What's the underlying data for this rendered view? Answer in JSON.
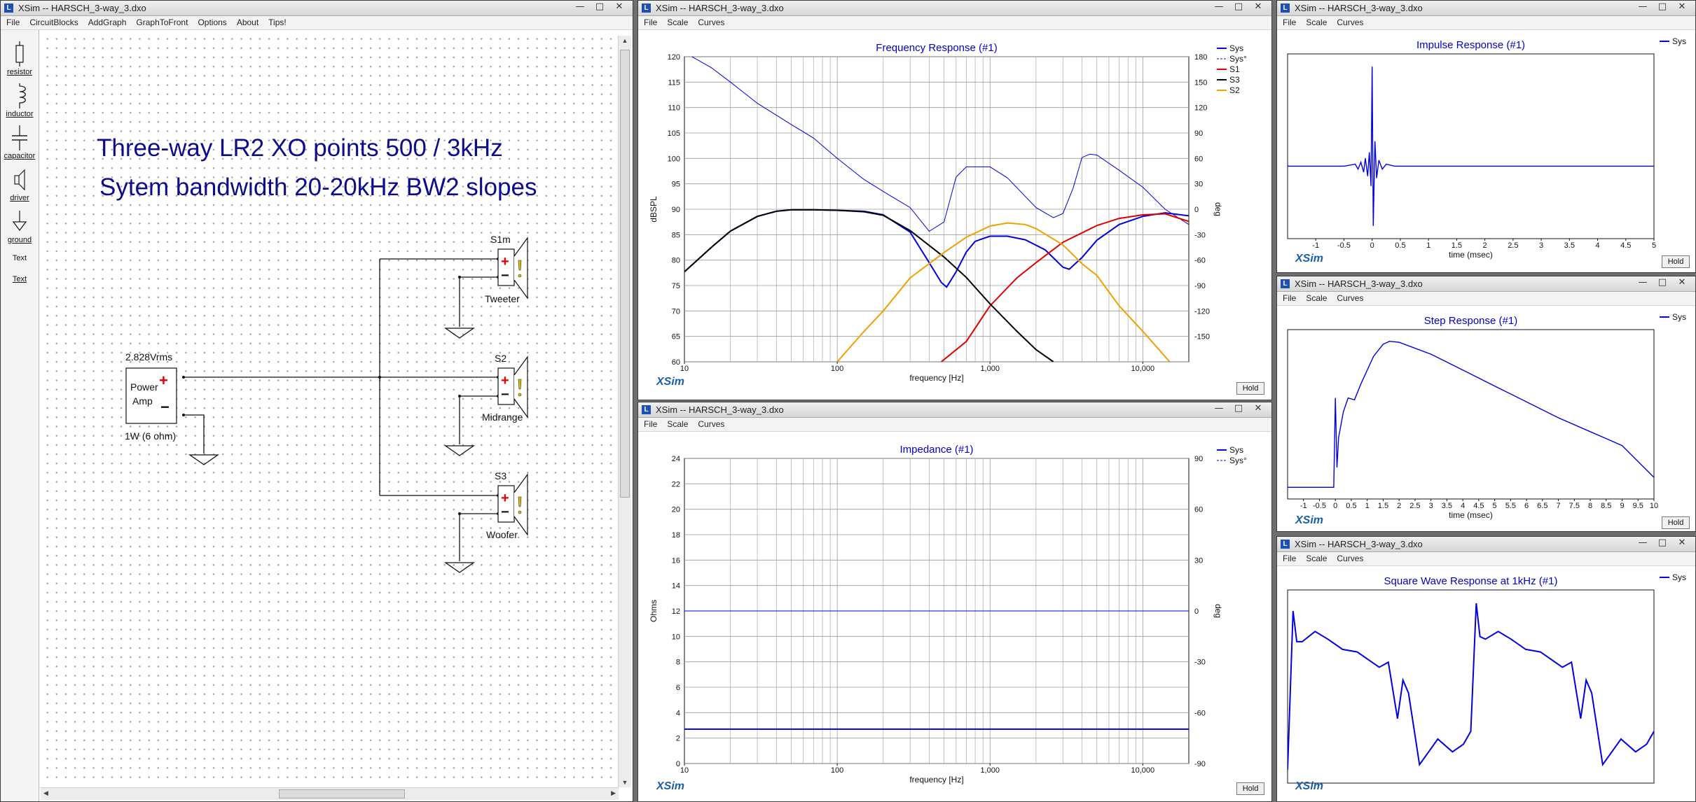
{
  "app_icon": "L",
  "window_controls": {
    "minimize": "—",
    "maximize": "□",
    "close": "✕"
  },
  "icons": [
    "resistor-icon",
    "inductor-icon",
    "capacitor-icon",
    "driver-icon",
    "ground-icon",
    "minimize-icon",
    "maximize-icon",
    "close-icon",
    "scroll-up-icon",
    "scroll-down-icon",
    "scroll-left-icon",
    "scroll-right-icon"
  ],
  "colors": {
    "title_blue": "#0000cc",
    "sys": "#0000e0",
    "s1": "#e00000",
    "s2": "#f0a000",
    "s3": "#000000",
    "xsim_logo": "#1b5fa8"
  },
  "schematic": {
    "title": "XSim -- HARSCH_3-way_3.dxo",
    "menu": [
      "File",
      "CircuitBlocks",
      "AddGraph",
      "GraphToFront",
      "Options",
      "About",
      "Tips!"
    ],
    "tools": [
      {
        "icon": "resistor-icon",
        "label": "resistor"
      },
      {
        "icon": "inductor-icon",
        "label": "inductor"
      },
      {
        "icon": "capacitor-icon",
        "label": "capacitor"
      },
      {
        "icon": "driver-icon",
        "label": "driver"
      },
      {
        "icon": "ground-icon",
        "label": "ground"
      },
      {
        "icon": "",
        "label": "Text"
      },
      {
        "icon": "",
        "label": "Text"
      }
    ],
    "heading1": "Three-way LR2 XO points 500 / 3kHz",
    "heading2": "Sytem bandwidth 20-20kHz BW2 slopes",
    "amp": {
      "line1": "Power",
      "line2": "Amp",
      "voltage": "2.828Vrms",
      "rating": "1W (6 ohm)",
      "plus": "+",
      "minus": "−"
    },
    "drivers": [
      {
        "id": "S1m",
        "name": "Tweeter"
      },
      {
        "id": "S2",
        "name": "Midrange"
      },
      {
        "id": "S3",
        "name": "Woofer"
      }
    ]
  },
  "freq_window": {
    "title": "XSim -- HARSCH_3-way_3.dxo",
    "menu": [
      "File",
      "Scale",
      "Curves"
    ],
    "logo": "XSim",
    "hold": "Hold",
    "chart_data": {
      "type": "line",
      "title": "Frequency Response (#1)",
      "xlabel": "frequency [Hz]",
      "ylabel": "dBSPL",
      "y2label": "deg",
      "xscale": "log",
      "xlim": [
        10,
        20000
      ],
      "ylim": [
        60,
        120
      ],
      "y2lim": [
        -180,
        180
      ],
      "x_ticks": [
        "10",
        "100",
        "1,000",
        "10,000"
      ],
      "y_ticks": [
        "60",
        "65",
        "70",
        "75",
        "80",
        "85",
        "90",
        "95",
        "100",
        "105",
        "110",
        "115",
        "120"
      ],
      "y2_ticks": [
        "-150",
        "-120",
        "-90",
        "-60",
        "-30",
        "0",
        "30",
        "60",
        "90",
        "120",
        "150",
        "180"
      ],
      "legend": [
        "Sys",
        "Sys°",
        "S1",
        "S3",
        "S2"
      ],
      "legend_position": "top-right",
      "grid": true,
      "series": [
        {
          "name": "Sys",
          "axis": "left",
          "points": [
            [
              10,
              77.7
            ],
            [
              15,
              82.5
            ],
            [
              20,
              85.7
            ],
            [
              30,
              88.6
            ],
            [
              40,
              89.6
            ],
            [
              50,
              89.9
            ],
            [
              70,
              89.9
            ],
            [
              100,
              89.8
            ],
            [
              150,
              89.6
            ],
            [
              200,
              88.9
            ],
            [
              300,
              85.5
            ],
            [
              400,
              79.5
            ],
            [
              480,
              75.6
            ],
            [
              520,
              74.7
            ],
            [
              600,
              77.7
            ],
            [
              700,
              81.6
            ],
            [
              800,
              83.7
            ],
            [
              1000,
              84.7
            ],
            [
              1300,
              84.7
            ],
            [
              1700,
              84.0
            ],
            [
              2300,
              82.0
            ],
            [
              3000,
              78.6
            ],
            [
              3300,
              78.2
            ],
            [
              4000,
              80.5
            ],
            [
              5000,
              83.9
            ],
            [
              7000,
              87.0
            ],
            [
              10000,
              88.6
            ],
            [
              14000,
              89.3
            ],
            [
              20000,
              88.7
            ]
          ]
        },
        {
          "name": "Sys°",
          "axis": "right",
          "points": [
            [
              10,
              185
            ],
            [
              15,
              167
            ],
            [
              20,
              150
            ],
            [
              30,
              125
            ],
            [
              50,
              100
            ],
            [
              70,
              84
            ],
            [
              100,
              60
            ],
            [
              150,
              35
            ],
            [
              200,
              21
            ],
            [
              300,
              2
            ],
            [
              400,
              -26
            ],
            [
              500,
              -15
            ],
            [
              600,
              38
            ],
            [
              700,
              50
            ],
            [
              1000,
              50
            ],
            [
              1300,
              37
            ],
            [
              2000,
              2
            ],
            [
              2600,
              -10
            ],
            [
              3000,
              -5
            ],
            [
              3500,
              25
            ],
            [
              4000,
              61
            ],
            [
              4500,
              65
            ],
            [
              5000,
              64
            ],
            [
              7000,
              46
            ],
            [
              10000,
              26
            ],
            [
              14000,
              0
            ],
            [
              20000,
              -18
            ]
          ]
        },
        {
          "name": "S1",
          "axis": "left",
          "points": [
            [
              480,
              60
            ],
            [
              700,
              64
            ],
            [
              1000,
              71
            ],
            [
              1500,
              76.5
            ],
            [
              2000,
              79.5
            ],
            [
              3000,
              83.5
            ],
            [
              5000,
              86.8
            ],
            [
              7000,
              88.2
            ],
            [
              10000,
              88.9
            ],
            [
              14000,
              89.1
            ],
            [
              20000,
              87.6
            ]
          ]
        },
        {
          "name": "S3",
          "axis": "left",
          "points": [
            [
              10,
              77.7
            ],
            [
              15,
              82.5
            ],
            [
              20,
              85.7
            ],
            [
              30,
              88.6
            ],
            [
              40,
              89.6
            ],
            [
              50,
              89.9
            ],
            [
              70,
              89.9
            ],
            [
              100,
              89.8
            ],
            [
              150,
              89.5
            ],
            [
              200,
              88.8
            ],
            [
              300,
              85.8
            ],
            [
              500,
              80.6
            ],
            [
              700,
              76.6
            ],
            [
              1000,
              71.4
            ],
            [
              1500,
              66
            ],
            [
              2000,
              62.4
            ],
            [
              2600,
              60
            ]
          ]
        },
        {
          "name": "S2",
          "axis": "left",
          "points": [
            [
              100,
              60
            ],
            [
              150,
              66
            ],
            [
              200,
              70
            ],
            [
              300,
              76.5
            ],
            [
              500,
              81.5
            ],
            [
              700,
              84.5
            ],
            [
              1000,
              86.7
            ],
            [
              1300,
              87.3
            ],
            [
              1700,
              87
            ],
            [
              2000,
              86.2
            ],
            [
              3000,
              83
            ],
            [
              4000,
              79.3
            ],
            [
              5000,
              77
            ],
            [
              7000,
              71
            ],
            [
              10000,
              66
            ],
            [
              15000,
              60
            ]
          ]
        }
      ]
    }
  },
  "impedance_window": {
    "title": "XSim -- HARSCH_3-way_3.dxo",
    "menu": [
      "File",
      "Scale",
      "Curves"
    ],
    "logo": "XSim",
    "hold": "Hold",
    "chart_data": {
      "type": "line",
      "title": "Impedance (#1)",
      "xlabel": "frequency [Hz]",
      "ylabel": "Ohms",
      "y2label": "deg",
      "xscale": "log",
      "xlim": [
        10,
        20000
      ],
      "ylim": [
        0,
        24
      ],
      "y2lim": [
        -90,
        90
      ],
      "x_ticks": [
        "10",
        "100",
        "1,000",
        "10,000"
      ],
      "y_ticks": [
        "0",
        "2",
        "4",
        "6",
        "8",
        "10",
        "12",
        "14",
        "16",
        "18",
        "20",
        "22",
        "24"
      ],
      "y2_ticks": [
        "-90",
        "-60",
        "-30",
        "0",
        "30",
        "60",
        "90"
      ],
      "legend": [
        "Sys",
        "Sys°"
      ],
      "legend_position": "top-right",
      "grid": true,
      "series": [
        {
          "name": "Sys",
          "axis": "left",
          "points": [
            [
              10,
              2.7
            ],
            [
              20000,
              2.7
            ]
          ]
        },
        {
          "name": "Sys°",
          "axis": "right",
          "points": [
            [
              10,
              0
            ],
            [
              20000,
              0
            ]
          ]
        }
      ]
    }
  },
  "impulse_window": {
    "title": "XSim -- HARSCH_3-way_3.dxo",
    "menu": [
      "File",
      "Scale",
      "Curves"
    ],
    "logo": "XSim",
    "hold": "Hold",
    "chart_data": {
      "type": "line",
      "title": "Impulse Response (#1)",
      "xlabel": "time (msec)",
      "xlim": [
        -1.5,
        5
      ],
      "x_ticks": [
        "-1",
        "-0.5",
        "0",
        "0.5",
        "1",
        "1.5",
        "2",
        "2.5",
        "3",
        "3.5",
        "4",
        "4.5",
        "5"
      ],
      "legend": [
        "Sys"
      ],
      "legend_position": "top-right",
      "grid": false,
      "series": [
        {
          "name": "Sys",
          "points": [
            [
              -1.5,
              0
            ],
            [
              -0.5,
              0
            ],
            [
              -0.3,
              0.02
            ],
            [
              -0.25,
              -0.03
            ],
            [
              -0.2,
              0.04
            ],
            [
              -0.15,
              -0.06
            ],
            [
              -0.12,
              0.08
            ],
            [
              -0.08,
              -0.1
            ],
            [
              -0.05,
              0.14
            ],
            [
              -0.02,
              -0.2
            ],
            [
              0,
              1.0
            ],
            [
              0.02,
              -0.6
            ],
            [
              0.05,
              0.25
            ],
            [
              0.08,
              -0.12
            ],
            [
              0.12,
              0.06
            ],
            [
              0.18,
              -0.03
            ],
            [
              0.25,
              0.02
            ],
            [
              0.4,
              0
            ],
            [
              1,
              0
            ],
            [
              2,
              0
            ],
            [
              3,
              0
            ],
            [
              5,
              0
            ]
          ]
        }
      ]
    }
  },
  "step_window": {
    "title": "XSim -- HARSCH_3-way_3.dxo",
    "menu": [
      "File",
      "Scale",
      "Curves"
    ],
    "logo": "XSim",
    "hold": "Hold",
    "chart_data": {
      "type": "line",
      "title": "Step Response (#1)",
      "xlabel": "time (msec)",
      "xlim": [
        -1.5,
        10
      ],
      "x_ticks": [
        "-1",
        "-0.5",
        "0",
        "0.5",
        "1",
        "1.5",
        "2",
        "2.5",
        "3",
        "3.5",
        "4",
        "4.5",
        "5",
        "5.5",
        "6",
        "6.5",
        "7",
        "7.5",
        "8",
        "8.5",
        "9",
        "9.5",
        "10"
      ],
      "legend": [
        "Sys"
      ],
      "legend_position": "top-right",
      "grid": false,
      "series": [
        {
          "name": "Sys",
          "points": [
            [
              -1.5,
              0
            ],
            [
              -0.05,
              0
            ],
            [
              0,
              0.45
            ],
            [
              0.05,
              0.1
            ],
            [
              0.1,
              0.25
            ],
            [
              0.25,
              0.38
            ],
            [
              0.4,
              0.45
            ],
            [
              0.6,
              0.44
            ],
            [
              0.8,
              0.52
            ],
            [
              1.2,
              0.66
            ],
            [
              1.5,
              0.72
            ],
            [
              1.7,
              0.735
            ],
            [
              2,
              0.73
            ],
            [
              3,
              0.67
            ],
            [
              4,
              0.59
            ],
            [
              5,
              0.51
            ],
            [
              6,
              0.43
            ],
            [
              7,
              0.35
            ],
            [
              8,
              0.28
            ],
            [
              9,
              0.21
            ],
            [
              10,
              0.05
            ]
          ]
        }
      ]
    }
  },
  "square_window": {
    "title": "XSim -- HARSCH_3-way_3.dxo",
    "menu": [
      "File",
      "Scale",
      "Curves"
    ],
    "logo": "XSim",
    "hold": "Hold",
    "chart_data": {
      "type": "line",
      "title": "Square Wave Response at 1kHz (#1)",
      "xlim": [
        0,
        2
      ],
      "legend": [
        "Sys"
      ],
      "legend_position": "top-right",
      "grid": false,
      "series": [
        {
          "name": "Sys",
          "points": [
            [
              0,
              0.2
            ],
            [
              0.03,
              0.82
            ],
            [
              0.05,
              0.7
            ],
            [
              0.08,
              0.7
            ],
            [
              0.15,
              0.74
            ],
            [
              0.22,
              0.71
            ],
            [
              0.3,
              0.67
            ],
            [
              0.38,
              0.66
            ],
            [
              0.5,
              0.6
            ],
            [
              0.55,
              0.62
            ],
            [
              0.6,
              0.4
            ],
            [
              0.63,
              0.55
            ],
            [
              0.66,
              0.5
            ],
            [
              0.72,
              0.22
            ],
            [
              0.78,
              0.28
            ],
            [
              0.82,
              0.32
            ],
            [
              0.9,
              0.27
            ],
            [
              0.96,
              0.3
            ],
            [
              1.0,
              0.35
            ],
            [
              1.03,
              0.85
            ],
            [
              1.05,
              0.72
            ],
            [
              1.08,
              0.71
            ],
            [
              1.15,
              0.74
            ],
            [
              1.22,
              0.71
            ],
            [
              1.3,
              0.67
            ],
            [
              1.38,
              0.66
            ],
            [
              1.5,
              0.6
            ],
            [
              1.55,
              0.62
            ],
            [
              1.6,
              0.4
            ],
            [
              1.63,
              0.55
            ],
            [
              1.66,
              0.5
            ],
            [
              1.72,
              0.22
            ],
            [
              1.78,
              0.28
            ],
            [
              1.82,
              0.32
            ],
            [
              1.9,
              0.27
            ],
            [
              1.96,
              0.3
            ],
            [
              2.0,
              0.35
            ]
          ]
        }
      ]
    }
  }
}
